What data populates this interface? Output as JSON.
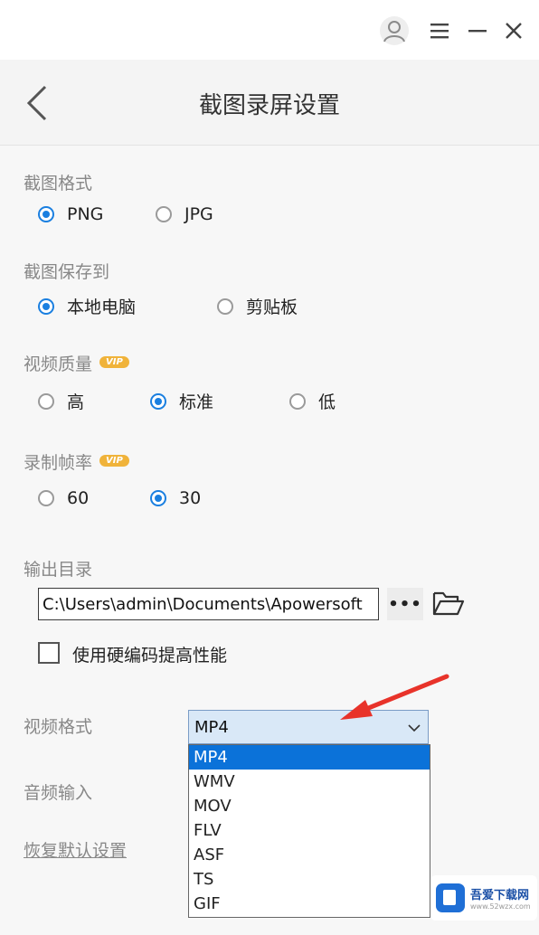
{
  "header": {
    "title": "截图录屏设置"
  },
  "sections": {
    "screenshot_format": {
      "label": "截图格式",
      "options": [
        "PNG",
        "JPG"
      ],
      "selected": "PNG"
    },
    "save_to": {
      "label": "截图保存到",
      "options": [
        "本地电脑",
        "剪贴板"
      ],
      "selected": "本地电脑"
    },
    "video_quality": {
      "label": "视频质量",
      "badge": "VIP",
      "options": [
        "高",
        "标准",
        "低"
      ],
      "selected": "标准"
    },
    "frame_rate": {
      "label": "录制帧率",
      "badge": "VIP",
      "options": [
        "60",
        "30"
      ],
      "selected": "30"
    },
    "output_dir": {
      "label": "输出目录",
      "value": "C:\\Users\\admin\\Documents\\Apowersoft",
      "more_label": "•••"
    },
    "hw_encoding": {
      "label": "使用硬编码提高性能",
      "checked": false
    },
    "video_format": {
      "label": "视频格式",
      "selected": "MP4",
      "options": [
        "MP4",
        "WMV",
        "MOV",
        "FLV",
        "ASF",
        "TS",
        "GIF"
      ]
    },
    "audio_input": {
      "label": "音频输入"
    },
    "reset": {
      "label": "恢复默认设置"
    }
  },
  "watermark": {
    "name": "吾爱下载网",
    "url": "www.52wzx.com"
  },
  "colors": {
    "accent": "#1a7fe0",
    "vip": "#f0b33a",
    "arrow": "#e8332a",
    "select_bg": "#d9e8f7",
    "option_selected": "#0b72d9"
  },
  "icons": [
    "user-icon",
    "menu-icon",
    "minimize-icon",
    "close-icon",
    "back-chevron-icon",
    "folder-open-icon",
    "chevron-down-icon",
    "arrow-annotation"
  ]
}
